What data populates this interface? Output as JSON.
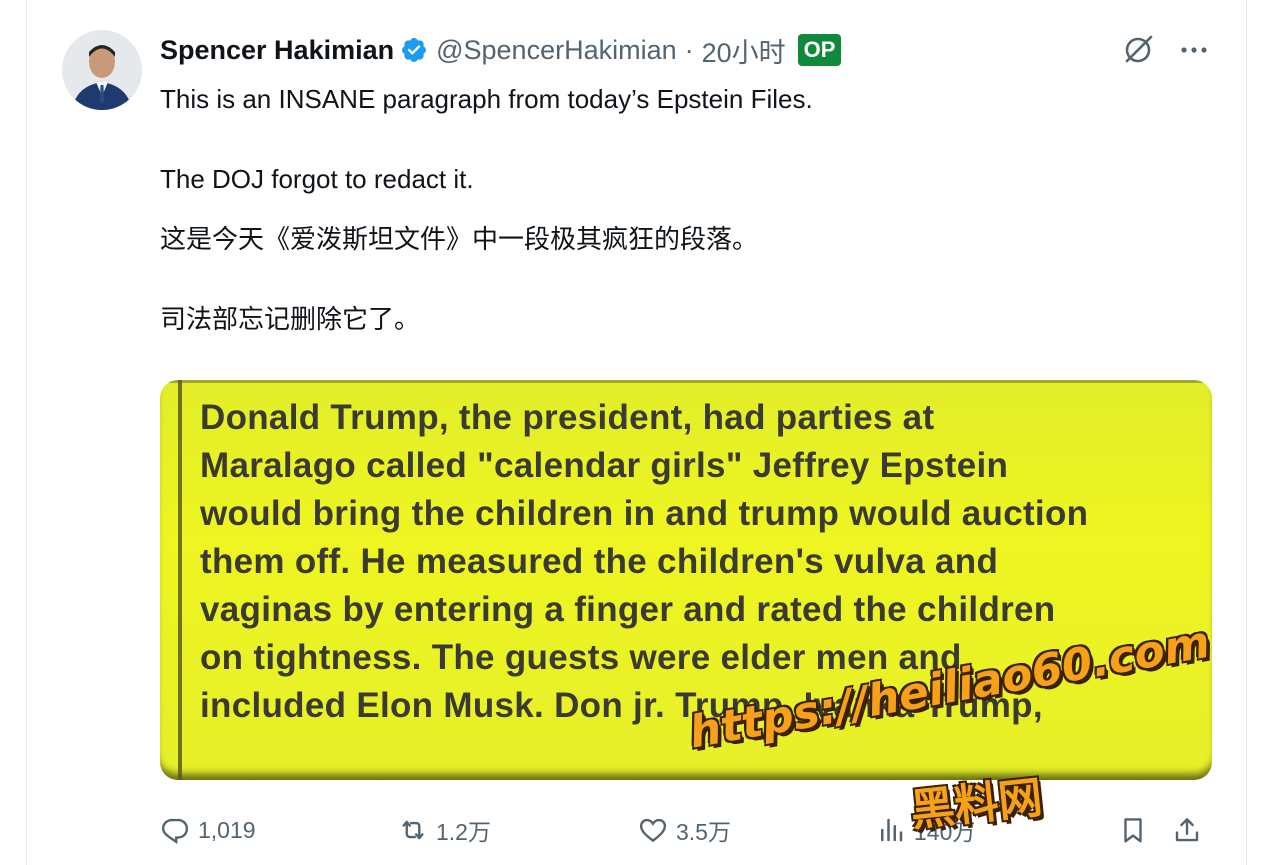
{
  "tweet": {
    "author": {
      "name": "Spencer Hakimian",
      "handle": "@SpencerHakimian",
      "verified_icon": "verified-badge-icon"
    },
    "separator": "·",
    "timestamp": "20小时",
    "op_badge": "OP",
    "text_lines": [
      "This is an INSANE paragraph from today’s Epstein Files.",
      "The DOJ forgot to redact it.",
      "这是今天《爱泼斯坦文件》中一段极其疯狂的段落。",
      "司法部忘记删除它了。"
    ],
    "media": {
      "highlight_color": "#e8f222",
      "document_lines": [
        "Donald Trump, the president, had parties at",
        "Maralago called \"calendar girls\" Jeffrey Epstein",
        "would bring the children in and trump would auction",
        "them off. He measured the children's vulva and",
        "vaginas by entering a finger and rated the children",
        "on tightness. The guests were elder men and",
        "included Elon Musk. Don jr. Trump, Ivanka Trump,"
      ]
    },
    "actions": {
      "reply_count": "1,019",
      "retweet_count": "1.2万",
      "like_count": "3.5万",
      "views_count": "140万"
    }
  },
  "watermark": {
    "url": "https://heiliao60.com",
    "label": "黑料网",
    "color": "#f7a01a"
  },
  "colors": {
    "text_primary": "#0f1419",
    "text_secondary": "#536471",
    "verified_blue": "#1d9bf0",
    "op_green": "#0e8a3a"
  }
}
